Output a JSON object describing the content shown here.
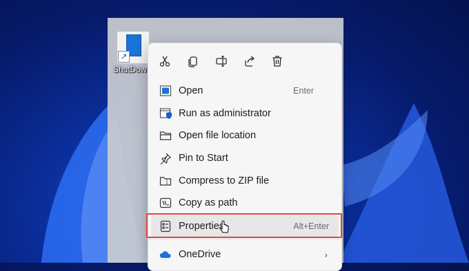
{
  "desktop": {
    "icon_label": "ShutDown"
  },
  "toolbar": {
    "buttons": [
      {
        "name": "cut-icon"
      },
      {
        "name": "copy-icon"
      },
      {
        "name": "rename-icon"
      },
      {
        "name": "share-icon"
      },
      {
        "name": "delete-icon"
      }
    ]
  },
  "menu": {
    "items": [
      {
        "label": "Open",
        "shortcut": "Enter",
        "icon": "open-icon"
      },
      {
        "label": "Run as administrator",
        "shortcut": "",
        "icon": "shield-window-icon"
      },
      {
        "label": "Open file location",
        "shortcut": "",
        "icon": "folder-icon"
      },
      {
        "label": "Pin to Start",
        "shortcut": "",
        "icon": "pin-icon"
      },
      {
        "label": "Compress to ZIP file",
        "shortcut": "",
        "icon": "zip-folder-icon"
      },
      {
        "label": "Copy as path",
        "shortcut": "",
        "icon": "copy-path-icon"
      },
      {
        "label": "Properties",
        "shortcut": "Alt+Enter",
        "icon": "properties-icon"
      },
      {
        "label": "OneDrive",
        "shortcut": "",
        "icon": "cloud-icon"
      }
    ]
  },
  "colors": {
    "highlight_border": "#e0463c",
    "accent": "#1a73d8"
  }
}
